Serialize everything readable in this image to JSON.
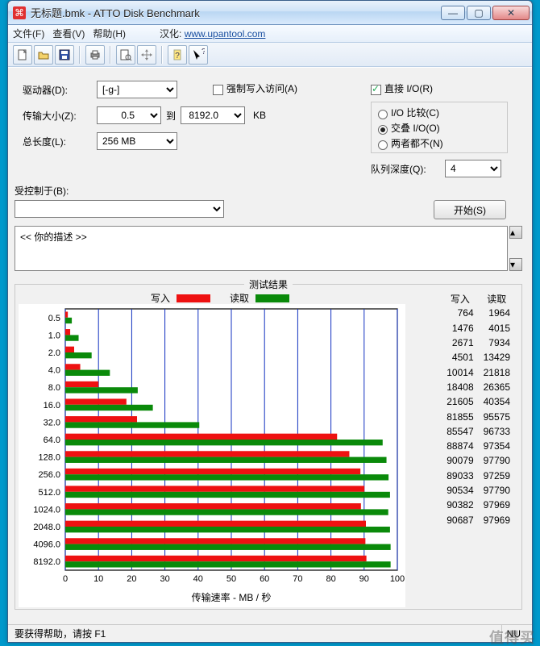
{
  "window": {
    "title": "无标题.bmk - ATTO Disk Benchmark",
    "btn_min": "—",
    "btn_max": "▢",
    "btn_close": "✕"
  },
  "menu": {
    "file": "文件(F)",
    "view": "查看(V)",
    "help": "帮助(H)",
    "hanhua_label": "汉化:",
    "hanhua_link": "www.upantool.com"
  },
  "labels": {
    "drive": "驱动器(D):",
    "transfer_size": "传输大小(Z):",
    "to": "到",
    "kb": "KB",
    "total_length": "总长度(L):",
    "force_write": "强制写入访问(A)",
    "direct_io": "直接 I/O(R)",
    "io_compare": "I/O 比较(C)",
    "overlapped": "交叠 I/O(O)",
    "neither": "两者都不(N)",
    "queue_depth": "队列深度(Q):",
    "controlled_by": "受控制于(B):",
    "start": "开始(S)",
    "description": "<< 你的描述   >>",
    "results_legend": "测试结果",
    "legend_write": "写入",
    "legend_read": "读取",
    "col_write": "写入",
    "col_read": "读取",
    "xlabel": "传输速率 - MB / 秒",
    "status_help": "要获得帮助，请按 F1",
    "status_right": "NU"
  },
  "values": {
    "drive": "[-g-]",
    "min_size": "0.5",
    "max_size": "8192.0",
    "total_length": "256 MB",
    "queue_depth": "4"
  },
  "checks": {
    "force_write": false,
    "direct_io": true,
    "radio_selected": "overlapped"
  },
  "chart_data": {
    "type": "bar",
    "xlabel": "传输速率 - MB / 秒",
    "xlim": [
      0,
      100
    ],
    "xticks": [
      0,
      10,
      20,
      30,
      40,
      50,
      60,
      70,
      80,
      90,
      100
    ],
    "categories": [
      "0.5",
      "1.0",
      "2.0",
      "4.0",
      "8.0",
      "16.0",
      "32.0",
      "64.0",
      "128.0",
      "256.0",
      "512.0",
      "1024.0",
      "2048.0",
      "4096.0",
      "8192.0"
    ],
    "series": [
      {
        "name": "写入",
        "color": "#e11",
        "values": [
          764,
          1476,
          2671,
          4501,
          10014,
          18408,
          21605,
          81855,
          85547,
          88874,
          90079,
          89033,
          90534,
          90382,
          90687
        ]
      },
      {
        "name": "读取",
        "color": "#0a8a0a",
        "values": [
          1964,
          4015,
          7934,
          13429,
          21818,
          26365,
          40354,
          95575,
          96733,
          97354,
          97790,
          97259,
          97790,
          97969,
          97969
        ]
      }
    ]
  },
  "watermark": "值得买"
}
